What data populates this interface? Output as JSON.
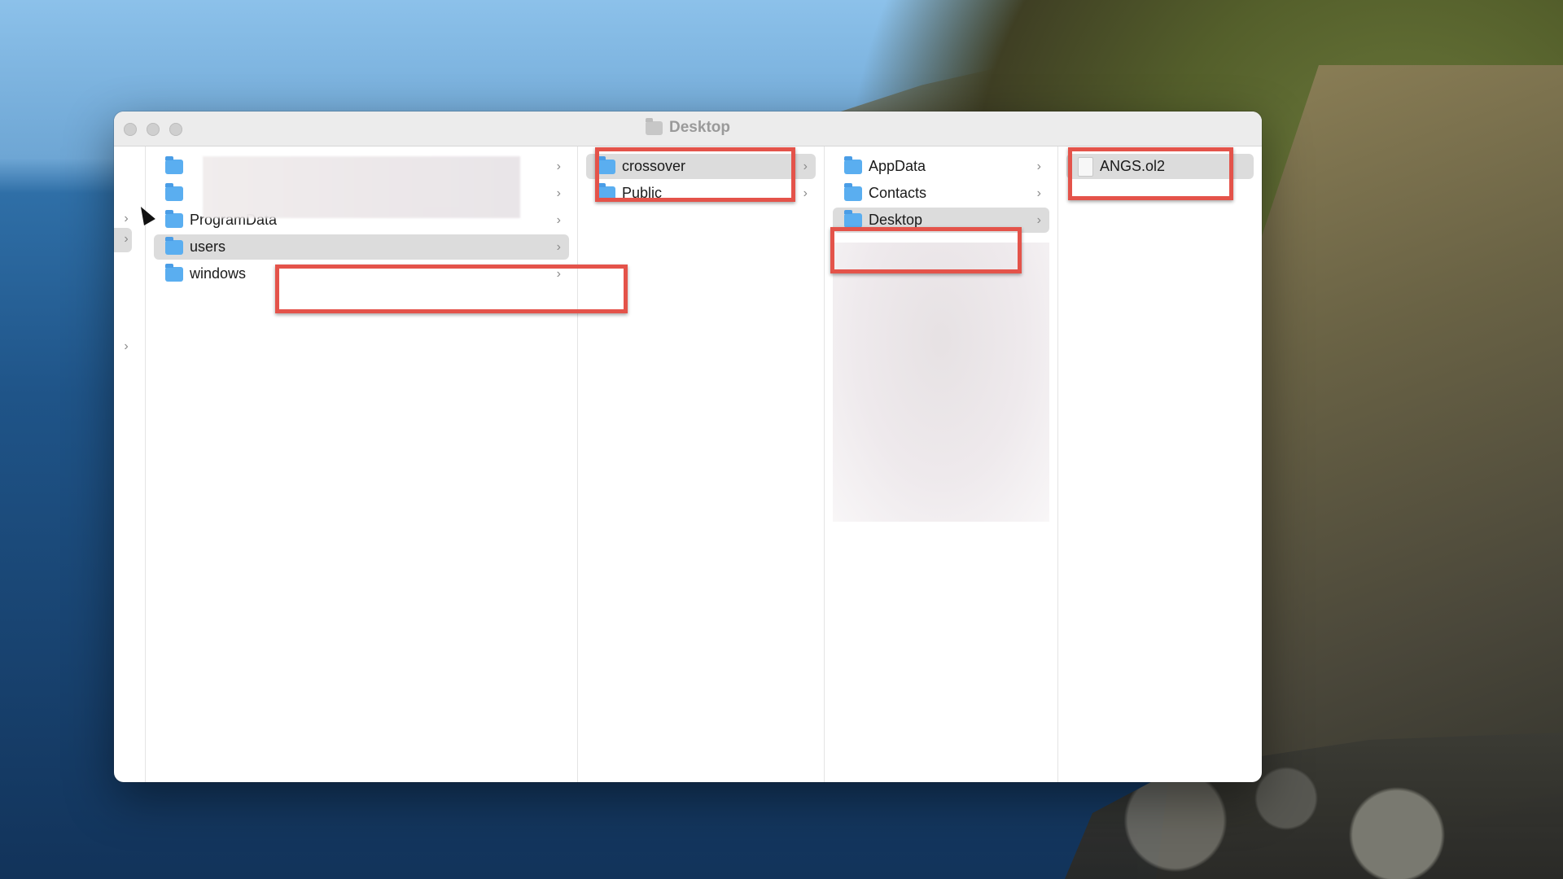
{
  "window": {
    "title": "Desktop",
    "title_icon": "folder-icon"
  },
  "columns": {
    "col1": [
      {
        "label": "",
        "icon": "folder-icon",
        "has_children": true
      },
      {
        "label": "",
        "icon": "folder-icon",
        "has_children": true
      },
      {
        "label": "ProgramData",
        "icon": "folder-icon",
        "has_children": true
      },
      {
        "label": "users",
        "icon": "folder-icon",
        "has_children": true,
        "selected": true
      },
      {
        "label": "windows",
        "icon": "folder-icon",
        "has_children": true
      }
    ],
    "col2": [
      {
        "label": "crossover",
        "icon": "folder-icon",
        "has_children": true,
        "selected": true
      },
      {
        "label": "Public",
        "icon": "folder-icon",
        "has_children": true
      }
    ],
    "col3": [
      {
        "label": "AppData",
        "icon": "folder-icon",
        "has_children": true
      },
      {
        "label": "Contacts",
        "icon": "folder-icon",
        "has_children": true
      },
      {
        "label": "Desktop",
        "icon": "folder-icon",
        "has_children": true,
        "selected": true
      }
    ],
    "col4": [
      {
        "label": "ANGS.ol2",
        "icon": "document-icon",
        "selected": true
      }
    ]
  },
  "colors": {
    "highlight": "#e4534a",
    "folder": "#5aaef0",
    "selection": "#dcdcdc"
  }
}
